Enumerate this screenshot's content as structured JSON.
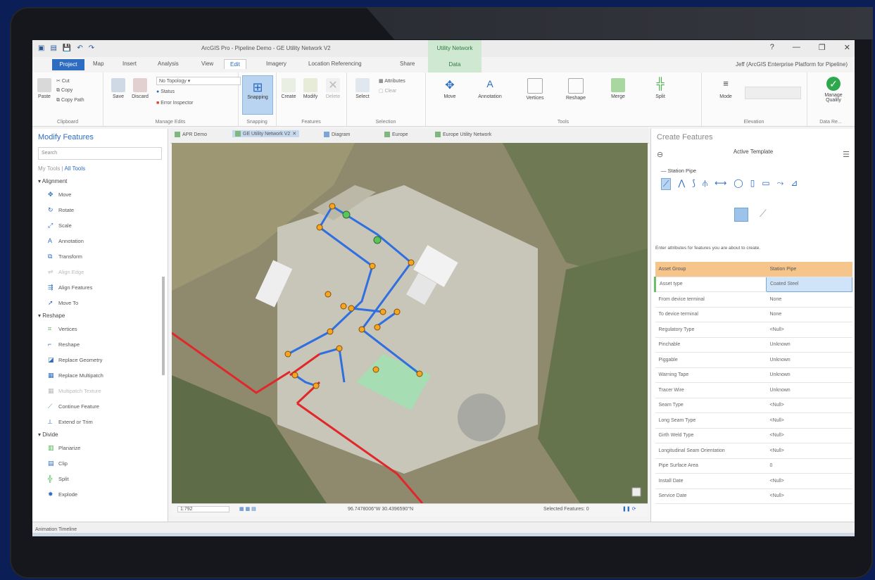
{
  "app": {
    "title": "ArcGIS Pro - Pipeline Demo - GE Utility Network V2",
    "contextual_group": "Utility Network",
    "account": "Jeff (ArcGIS Enterprise Platform for Pipeline)",
    "window_controls": [
      "?",
      "—",
      "❐",
      "✕"
    ]
  },
  "ribbon_tabs": [
    "Project",
    "Map",
    "Insert",
    "Analysis",
    "View",
    "Edit",
    "Imagery",
    "Location Referencing",
    "Share",
    "Data"
  ],
  "ribbon": {
    "clipboard": {
      "paste": "Paste",
      "cut": "Cut",
      "copy": "Copy",
      "copy_path": "Copy Path",
      "label": "Clipboard"
    },
    "manage_edits": {
      "save": "Save",
      "discard": "Discard",
      "topology": "No Topology",
      "status": "Status",
      "error_inspector": "Error Inspector",
      "label": "Manage Edits"
    },
    "snapping": {
      "btn": "Snapping",
      "label": "Snapping"
    },
    "features": {
      "create": "Create",
      "modify": "Modify",
      "delete": "Delete",
      "label": "Features"
    },
    "selection": {
      "select": "Select",
      "attributes": "Attributes",
      "clear": "Clear",
      "label": "Selection"
    },
    "tools": {
      "move": "Move",
      "annotation": "Annotation",
      "vertices": "Vertices",
      "reshape": "Reshape",
      "merge": "Merge",
      "split": "Split",
      "label": "Tools"
    },
    "elevation": {
      "mode": "Mode",
      "label": "Elevation"
    },
    "quality": {
      "manage": "Manage Quality",
      "label": "Data Re..."
    }
  },
  "left_pane": {
    "title": "Modify Features",
    "search_placeholder": "Search",
    "my_tools": "My Tools",
    "all_tools": "All Tools",
    "alignment": {
      "title": "Alignment",
      "items": [
        "Move",
        "Rotate",
        "Scale",
        "Annotation",
        "Transform",
        "Align Edge",
        "Align Features",
        "Move To"
      ]
    },
    "reshape": {
      "title": "Reshape",
      "items": [
        "Vertices",
        "Reshape",
        "Replace Geometry",
        "Replace Multipatch",
        "Multipatch Texture",
        "Continue Feature",
        "Extend or Trim"
      ]
    },
    "divide": {
      "title": "Divide",
      "items": [
        "Planarize",
        "Clip",
        "Split",
        "Explode"
      ]
    }
  },
  "map_tabs": [
    "APR Demo",
    "GE Utility Network V2",
    "Diagram",
    "Europe",
    "Europe Utility Network"
  ],
  "status_bar": {
    "scale": "1:792",
    "coords": "96.7478006°W 30.4396590°N",
    "selected": "Selected Features: 0"
  },
  "right_pane": {
    "title": "Create Features",
    "active_template": "Active Template",
    "template_name": "Station Pipe",
    "hint": "Enter attributes for features you are about to create.",
    "attributes": [
      {
        "name": "Asset Group",
        "value": "Station Pipe"
      },
      {
        "name": "Asset type",
        "value": "Coated Steel"
      },
      {
        "name": "From device terminal",
        "value": "None"
      },
      {
        "name": "To device terminal",
        "value": "None"
      },
      {
        "name": "Regulatory Type",
        "value": "<Null>"
      },
      {
        "name": "Pinchable",
        "value": "Unknown"
      },
      {
        "name": "Piggable",
        "value": "Unknown"
      },
      {
        "name": "Warning Tape",
        "value": "Unknown"
      },
      {
        "name": "Tracer Wire",
        "value": "Unknown"
      },
      {
        "name": "Seam Type",
        "value": "<Null>"
      },
      {
        "name": "Long Seam Type",
        "value": "<Null>"
      },
      {
        "name": "Girth Weld Type",
        "value": "<Null>"
      },
      {
        "name": "Longitudinal Seam Orientation",
        "value": "<Null>"
      },
      {
        "name": "Pipe Surface Area",
        "value": "0"
      },
      {
        "name": "Install Date",
        "value": "<Null>"
      },
      {
        "name": "Service Date",
        "value": "<Null>"
      }
    ]
  },
  "bottom_tab": "Animation Timeline",
  "colors": {
    "accent": "#2d6cc0",
    "pipe_station": "#2f6fe0",
    "pipe_main": "#e0282a",
    "context_green": "#cfe8d2",
    "attr_header": "#f6c58b"
  }
}
